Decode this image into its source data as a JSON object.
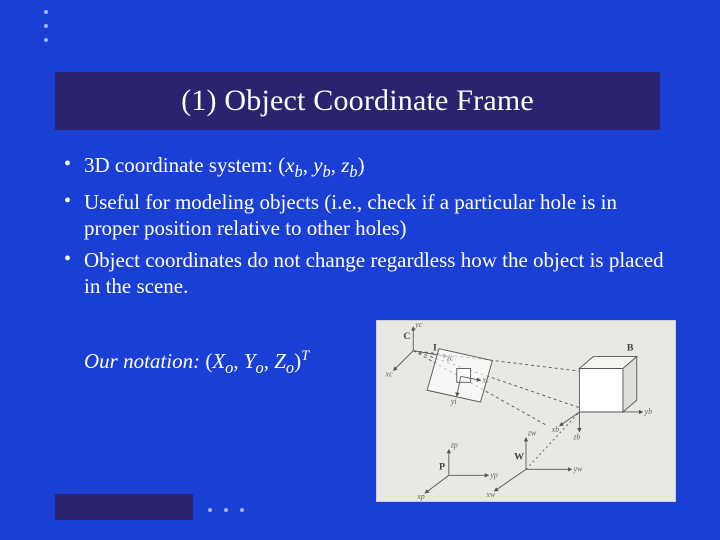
{
  "title": "(1) Object Coordinate Frame",
  "bullets": [
    {
      "prefix": "3D coordinate system: (",
      "var1": "x",
      "sub1": "b",
      "sep1": ", ",
      "var2": "y",
      "sub2": "b",
      "sep2": ", ",
      "var3": "z",
      "sub3": "b",
      "suffix": ")"
    },
    {
      "text": "Useful for modeling objects (i.e., check if a particular hole is in proper position relative to other holes)"
    },
    {
      "text": "Object coordinates do not change regardless how the object is placed in the scene."
    }
  ],
  "notation": {
    "lead": "Our notation:",
    "open": " (",
    "v1": "X",
    "s1": "o",
    "c1": ", ",
    "v2": "Y",
    "s2": "o",
    "c2": ", ",
    "v3": "Z",
    "s3": "o",
    "close": ")",
    "sup": "T"
  },
  "figure": {
    "labels": {
      "C": "C",
      "I": "I",
      "cube": "B",
      "W": "W",
      "P": "P",
      "xc": "xc",
      "yc": "yc",
      "zc": "zc",
      "xi": "xi",
      "yi": "yi",
      "xp": "xp",
      "yp": "yp",
      "zp": "zp",
      "xw": "xw",
      "yw": "yw",
      "zw": "zw",
      "xb": "xb",
      "yb": "yb",
      "zb": "zb"
    }
  }
}
